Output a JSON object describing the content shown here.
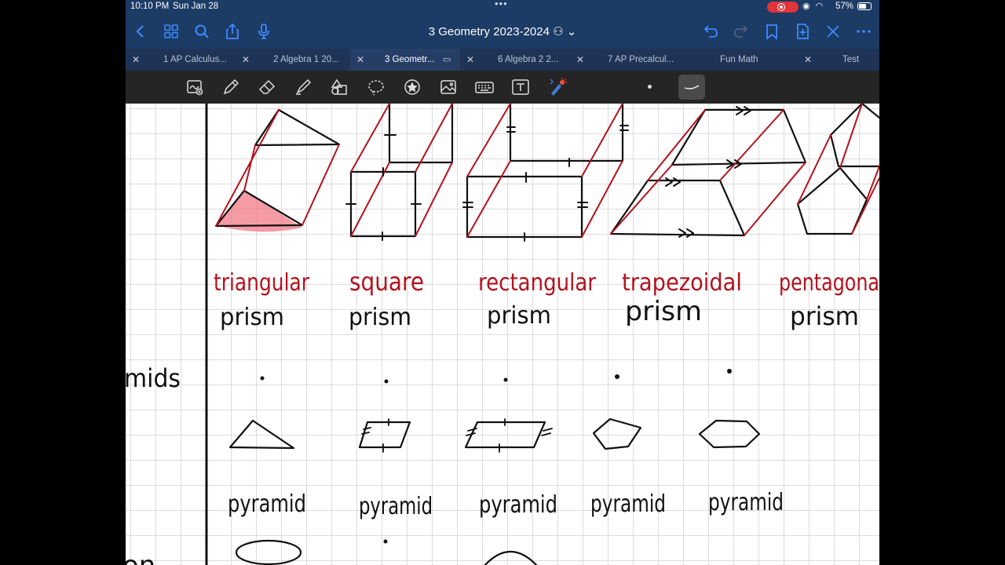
{
  "status": {
    "time": "10:10 PM",
    "date": "Sun Jan 28",
    "battery": "57%"
  },
  "nav": {
    "title": "3 Geometry 2023-2024",
    "icons": [
      "back-icon",
      "thumbnails-icon",
      "search-icon",
      "share-icon",
      "microphone-icon",
      "undo-icon",
      "redo-icon",
      "bookmark-icon",
      "add-page-icon",
      "close-icon",
      "more-icon"
    ]
  },
  "tabs": [
    {
      "label": "1 AP Calculus..."
    },
    {
      "label": "2 Algebra 1 20..."
    },
    {
      "label": "3 Geometr..."
    },
    {
      "label": "6 Algebra 2 2..."
    },
    {
      "label": "7 AP Precalcul..."
    },
    {
      "label": "Fun Math"
    },
    {
      "label": "Test"
    }
  ],
  "toolbar": {
    "tools": [
      "lasso-read-icon",
      "pen-icon",
      "eraser-icon",
      "highlighter-icon",
      "shapes-icon",
      "lasso-icon",
      "sticker-icon",
      "image-icon",
      "keyboard-icon",
      "text-icon",
      "laser-pointer-icon"
    ]
  },
  "notes": {
    "prisms": [
      {
        "name": "triangular",
        "kind": "prism"
      },
      {
        "name": "square",
        "kind": "prism"
      },
      {
        "name": "rectangular",
        "kind": "prism"
      },
      {
        "name": "trapezoidal",
        "kind": "prism"
      },
      {
        "name": "pentagona",
        "kind": "prism"
      }
    ],
    "side_label": "mids",
    "pyramid_label": "pyramid",
    "bottom_partial": "on"
  },
  "colors": {
    "nav_bg": "#1c3b65",
    "tab_bg": "#1f3356",
    "toolbar_bg": "#252525",
    "ink_black": "#111111",
    "ink_red": "#b3121d",
    "highlight": "#f07a86"
  }
}
